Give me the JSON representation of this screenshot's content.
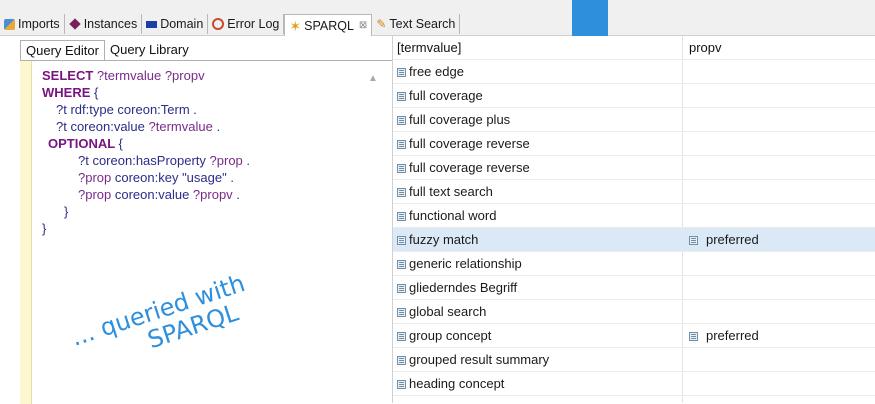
{
  "tabs": [
    {
      "label": "Imports",
      "icon": "imports-icon"
    },
    {
      "label": "Instances",
      "icon": "diamond-icon"
    },
    {
      "label": "Domain",
      "icon": "domain-icon"
    },
    {
      "label": "Error Log",
      "icon": "error-log-icon"
    },
    {
      "label": "SPARQL",
      "icon": "star-icon",
      "active": true
    },
    {
      "label": "Text Search",
      "icon": "pencil-icon"
    }
  ],
  "close_glyph": "⊠",
  "left": {
    "subtabs": [
      "Query Editor",
      "Query Library"
    ],
    "query_lines": [
      [
        [
          "kw",
          "SELECT "
        ],
        [
          "var",
          "?termvalue ?propv"
        ]
      ],
      [
        [
          "kw",
          "WHERE "
        ],
        [
          "txt",
          "{"
        ]
      ],
      [
        [
          "txt",
          "?t rdf:type coreon:Term ."
        ]
      ],
      [
        [
          "txt",
          "?t coreon:value "
        ],
        [
          "var",
          "?termvalue"
        ],
        [
          "txt",
          " ."
        ]
      ],
      [
        [
          "kw",
          "OPTIONAL "
        ],
        [
          "txt",
          "{"
        ]
      ],
      [
        [
          "txt",
          "?t coreon:hasProperty "
        ],
        [
          "var",
          "?prop"
        ],
        [
          "txt",
          " ."
        ]
      ],
      [
        [
          "var",
          "?prop"
        ],
        [
          "txt",
          " coreon:key \"usage\" ."
        ]
      ],
      [
        [
          "var",
          "?prop"
        ],
        [
          "txt",
          " coreon:value "
        ],
        [
          "var",
          "?propv"
        ],
        [
          "txt",
          " ."
        ]
      ],
      [
        [
          "txt",
          "}"
        ]
      ],
      [
        [
          "txt",
          "}"
        ]
      ]
    ],
    "annotation": [
      "... queried with",
      "SPARQL"
    ]
  },
  "results": {
    "columns": [
      "[termvalue]",
      "propv"
    ],
    "rows": [
      {
        "term": "free edge",
        "prop": ""
      },
      {
        "term": "full coverage",
        "prop": ""
      },
      {
        "term": "full coverage plus",
        "prop": ""
      },
      {
        "term": "full coverage reverse",
        "prop": ""
      },
      {
        "term": "full coverage reverse",
        "prop": ""
      },
      {
        "term": "full text search",
        "prop": ""
      },
      {
        "term": "functional word",
        "prop": ""
      },
      {
        "term": "fuzzy match",
        "prop": "preferred",
        "selected": true
      },
      {
        "term": "generic relationship",
        "prop": ""
      },
      {
        "term": "gliederndes Begriff",
        "prop": ""
      },
      {
        "term": "global search",
        "prop": ""
      },
      {
        "term": "group concept",
        "prop": "preferred"
      },
      {
        "term": "grouped result summary",
        "prop": ""
      },
      {
        "term": "heading concept",
        "prop": ""
      }
    ]
  },
  "colors": {
    "accent_blue": "#2e8fdd",
    "selected_row": "#dbe9f7",
    "keyword": "#7a1480"
  }
}
